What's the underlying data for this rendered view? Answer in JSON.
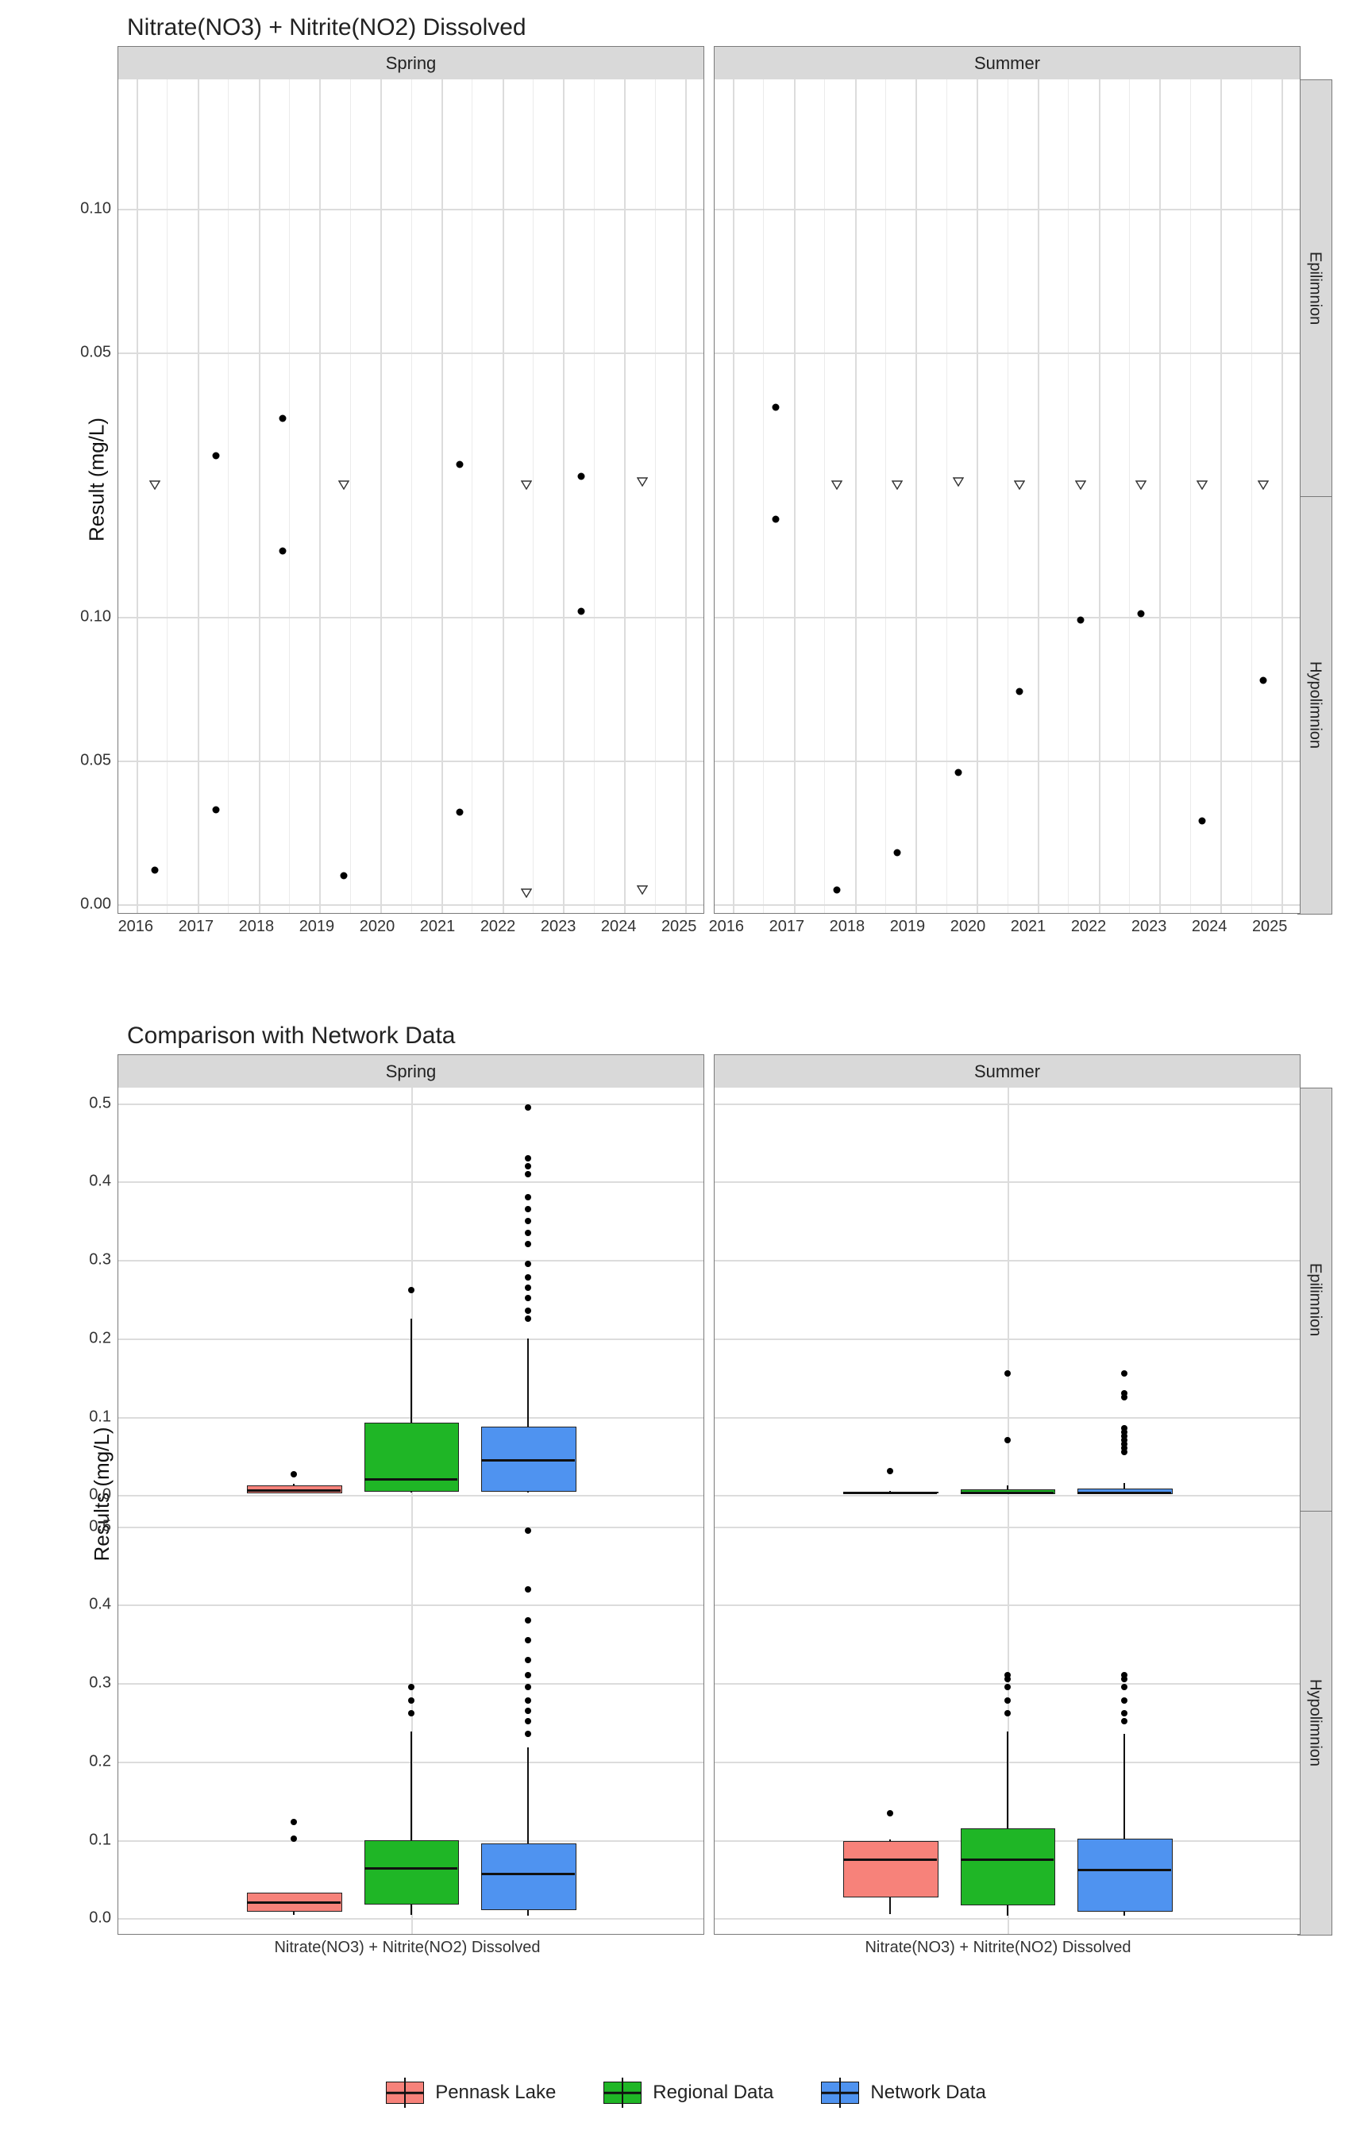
{
  "chart_data": [
    {
      "id": "scatter_facets",
      "type": "scatter",
      "title": "Nitrate(NO3) + Nitrite(NO2) Dissolved",
      "ylabel": "Result (mg/L)",
      "x_ticks": [
        2016,
        2017,
        2018,
        2019,
        2020,
        2021,
        2022,
        2023,
        2024,
        2025
      ],
      "x_range": [
        2015.7,
        2025.3
      ],
      "yticks_top": [
        0.05,
        0.1
      ],
      "yticks_bottom": [
        0.0,
        0.05,
        0.1
      ],
      "facet_cols": [
        "Spring",
        "Summer"
      ],
      "facet_rows": [
        "Epilimnion",
        "Hypolimnion"
      ],
      "ylim_top": [
        0.0,
        0.145
      ],
      "ylim_bottom": [
        -0.003,
        0.142
      ],
      "shape_meaning": {
        "triangle_open": "below detection / censored",
        "dot": "measured"
      },
      "panels": {
        "Spring_Epilimnion": [
          {
            "x": 2016.3,
            "y": 0.004,
            "shape": "tri"
          },
          {
            "x": 2017.3,
            "y": 0.014,
            "shape": "dot"
          },
          {
            "x": 2018.4,
            "y": 0.027,
            "shape": "dot"
          },
          {
            "x": 2019.4,
            "y": 0.004,
            "shape": "tri"
          },
          {
            "x": 2021.3,
            "y": 0.011,
            "shape": "dot"
          },
          {
            "x": 2022.4,
            "y": 0.004,
            "shape": "tri"
          },
          {
            "x": 2023.3,
            "y": 0.007,
            "shape": "dot"
          },
          {
            "x": 2024.3,
            "y": 0.005,
            "shape": "tri"
          }
        ],
        "Summer_Epilimnion": [
          {
            "x": 2016.7,
            "y": 0.031,
            "shape": "dot"
          },
          {
            "x": 2017.7,
            "y": 0.004,
            "shape": "tri"
          },
          {
            "x": 2018.7,
            "y": 0.004,
            "shape": "tri"
          },
          {
            "x": 2019.7,
            "y": 0.005,
            "shape": "tri"
          },
          {
            "x": 2020.7,
            "y": 0.004,
            "shape": "tri"
          },
          {
            "x": 2021.7,
            "y": 0.004,
            "shape": "tri"
          },
          {
            "x": 2022.7,
            "y": 0.004,
            "shape": "tri"
          },
          {
            "x": 2023.7,
            "y": 0.004,
            "shape": "tri"
          },
          {
            "x": 2024.7,
            "y": 0.004,
            "shape": "tri"
          }
        ],
        "Spring_Hypolimnion": [
          {
            "x": 2016.3,
            "y": 0.012,
            "shape": "dot"
          },
          {
            "x": 2017.3,
            "y": 0.033,
            "shape": "dot"
          },
          {
            "x": 2018.4,
            "y": 0.123,
            "shape": "dot"
          },
          {
            "x": 2019.4,
            "y": 0.01,
            "shape": "dot"
          },
          {
            "x": 2021.3,
            "y": 0.032,
            "shape": "dot"
          },
          {
            "x": 2022.4,
            "y": 0.004,
            "shape": "tri"
          },
          {
            "x": 2023.3,
            "y": 0.102,
            "shape": "dot"
          },
          {
            "x": 2024.3,
            "y": 0.005,
            "shape": "tri"
          }
        ],
        "Summer_Hypolimnion": [
          {
            "x": 2016.7,
            "y": 0.134,
            "shape": "dot"
          },
          {
            "x": 2017.7,
            "y": 0.005,
            "shape": "dot"
          },
          {
            "x": 2018.7,
            "y": 0.018,
            "shape": "dot"
          },
          {
            "x": 2019.7,
            "y": 0.046,
            "shape": "dot"
          },
          {
            "x": 2020.7,
            "y": 0.074,
            "shape": "dot"
          },
          {
            "x": 2021.7,
            "y": 0.099,
            "shape": "dot"
          },
          {
            "x": 2022.7,
            "y": 0.101,
            "shape": "dot"
          },
          {
            "x": 2023.7,
            "y": 0.029,
            "shape": "dot"
          },
          {
            "x": 2024.7,
            "y": 0.078,
            "shape": "dot"
          }
        ]
      }
    },
    {
      "id": "box_facets",
      "type": "box",
      "title": "Comparison with Network Data",
      "ylabel": "Results (mg/L)",
      "x_category": "Nitrate(NO3) + Nitrite(NO2) Dissolved",
      "facet_cols": [
        "Spring",
        "Summer"
      ],
      "facet_rows": [
        "Epilimnion",
        "Hypolimnion"
      ],
      "ylim": [
        -0.02,
        0.52
      ],
      "yticks": [
        0.0,
        0.1,
        0.2,
        0.3,
        0.4,
        0.5
      ],
      "box_width": 0.18,
      "series": [
        "Pennask Lake",
        "Regional Data",
        "Network Data"
      ],
      "colors": {
        "Pennask Lake": "#f7827a",
        "Regional Data": "#1fb626",
        "Network Data": "#4f93f0"
      },
      "panels": {
        "Spring_Epilimnion": {
          "Pennask Lake": {
            "min": 0.004,
            "q1": 0.004,
            "med": 0.007,
            "q3": 0.012,
            "max": 0.014,
            "out": [
              0.027
            ]
          },
          "Regional Data": {
            "min": 0.003,
            "q1": 0.006,
            "med": 0.022,
            "q3": 0.092,
            "max": 0.225,
            "out": [
              0.262
            ]
          },
          "Network Data": {
            "min": 0.003,
            "q1": 0.006,
            "med": 0.046,
            "q3": 0.087,
            "max": 0.2,
            "out": [
              0.225,
              0.235,
              0.252,
              0.265,
              0.278,
              0.295,
              0.32,
              0.335,
              0.35,
              0.365,
              0.38,
              0.41,
              0.42,
              0.43,
              0.495
            ]
          }
        },
        "Summer_Epilimnion": {
          "Pennask Lake": {
            "min": 0.004,
            "q1": 0.004,
            "med": 0.004,
            "q3": 0.004,
            "max": 0.005,
            "out": [
              0.031
            ]
          },
          "Regional Data": {
            "min": 0.003,
            "q1": 0.003,
            "med": 0.004,
            "q3": 0.007,
            "max": 0.012,
            "out": [
              0.07,
              0.155
            ]
          },
          "Network Data": {
            "min": 0.003,
            "q1": 0.003,
            "med": 0.004,
            "q3": 0.008,
            "max": 0.015,
            "out": [
              0.055,
              0.06,
              0.065,
              0.07,
              0.075,
              0.08,
              0.085,
              0.125,
              0.13,
              0.155
            ]
          }
        },
        "Spring_Hypolimnion": {
          "Pennask Lake": {
            "min": 0.004,
            "q1": 0.01,
            "med": 0.022,
            "q3": 0.033,
            "max": 0.033,
            "out": [
              0.102,
              0.123
            ]
          },
          "Regional Data": {
            "min": 0.004,
            "q1": 0.02,
            "med": 0.065,
            "q3": 0.1,
            "max": 0.238,
            "out": [
              0.262,
              0.278,
              0.295
            ]
          },
          "Network Data": {
            "min": 0.003,
            "q1": 0.012,
            "med": 0.058,
            "q3": 0.095,
            "max": 0.218,
            "out": [
              0.235,
              0.252,
              0.265,
              0.278,
              0.295,
              0.31,
              0.33,
              0.355,
              0.38,
              0.42,
              0.495
            ]
          }
        },
        "Summer_Hypolimnion": {
          "Pennask Lake": {
            "min": 0.005,
            "q1": 0.029,
            "med": 0.076,
            "q3": 0.099,
            "max": 0.101,
            "out": [
              0.134
            ]
          },
          "Regional Data": {
            "min": 0.003,
            "q1": 0.018,
            "med": 0.076,
            "q3": 0.115,
            "max": 0.238,
            "out": [
              0.262,
              0.278,
              0.295,
              0.305,
              0.31
            ]
          },
          "Network Data": {
            "min": 0.003,
            "q1": 0.01,
            "med": 0.063,
            "q3": 0.102,
            "max": 0.235,
            "out": [
              0.252,
              0.262,
              0.278,
              0.295,
              0.305,
              0.31
            ]
          }
        }
      }
    }
  ],
  "legend": {
    "items": [
      {
        "label": "Pennask Lake",
        "color": "#f7827a"
      },
      {
        "label": "Regional Data",
        "color": "#1fb626"
      },
      {
        "label": "Network Data",
        "color": "#4f93f0"
      }
    ]
  }
}
